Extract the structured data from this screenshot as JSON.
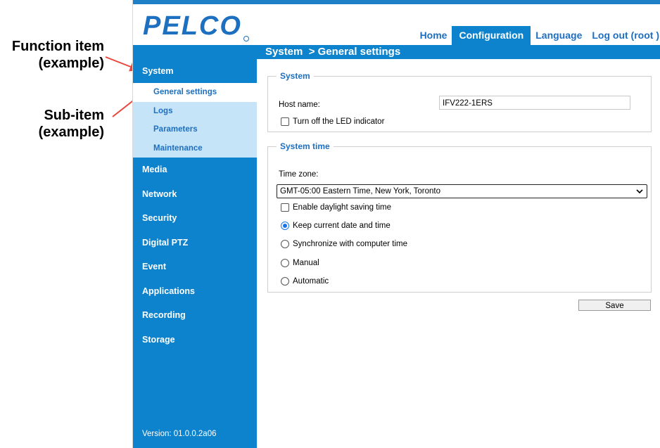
{
  "annotations": {
    "function_item": "Function item\n(example)",
    "sub_item": "Sub-item\n(example)"
  },
  "brand": {
    "logo_text": "PELCO"
  },
  "nav": {
    "tabs": [
      {
        "label": "Home",
        "active": false
      },
      {
        "label": "Configuration",
        "active": true
      },
      {
        "label": "Language",
        "active": false
      },
      {
        "label": "Log out (root )",
        "active": false
      }
    ]
  },
  "breadcrumb": "System  > General settings",
  "sidebar": {
    "items": [
      {
        "label": "System",
        "expanded": true
      },
      {
        "label": "Media"
      },
      {
        "label": "Network"
      },
      {
        "label": "Security"
      },
      {
        "label": "Digital PTZ"
      },
      {
        "label": "Event"
      },
      {
        "label": "Applications"
      },
      {
        "label": "Recording"
      },
      {
        "label": "Storage"
      }
    ],
    "subitems": [
      {
        "label": "General settings",
        "active": true
      },
      {
        "label": "Logs"
      },
      {
        "label": "Parameters"
      },
      {
        "label": "Maintenance"
      }
    ],
    "version": "Version: 01.0.0.2a06"
  },
  "system_group": {
    "legend": "System",
    "host_name_label": "Host name:",
    "host_name_value": "IFV222-1ERS",
    "led_label": "Turn off the LED indicator",
    "led_checked": false
  },
  "time_group": {
    "legend": "System time",
    "time_zone_label": "Time zone:",
    "time_zone_value": "GMT-05:00 Eastern Time, New York, Toronto",
    "dst_label": "Enable daylight saving time",
    "dst_checked": false,
    "options": [
      {
        "label": "Keep current date and time",
        "checked": true
      },
      {
        "label": "Synchronize with computer time",
        "checked": false
      },
      {
        "label": "Manual",
        "checked": false
      },
      {
        "label": "Automatic",
        "checked": false
      }
    ]
  },
  "save_label": "Save",
  "colors": {
    "primary_blue": "#0e83cd",
    "submenu_bg": "#c5e4f8",
    "link_blue": "#1d6fc0",
    "annotation_arrow": "#e8463c"
  },
  "icons": {
    "select_chevron": "chevron-down-icon",
    "annotation_arrow": "arrow-icon"
  }
}
